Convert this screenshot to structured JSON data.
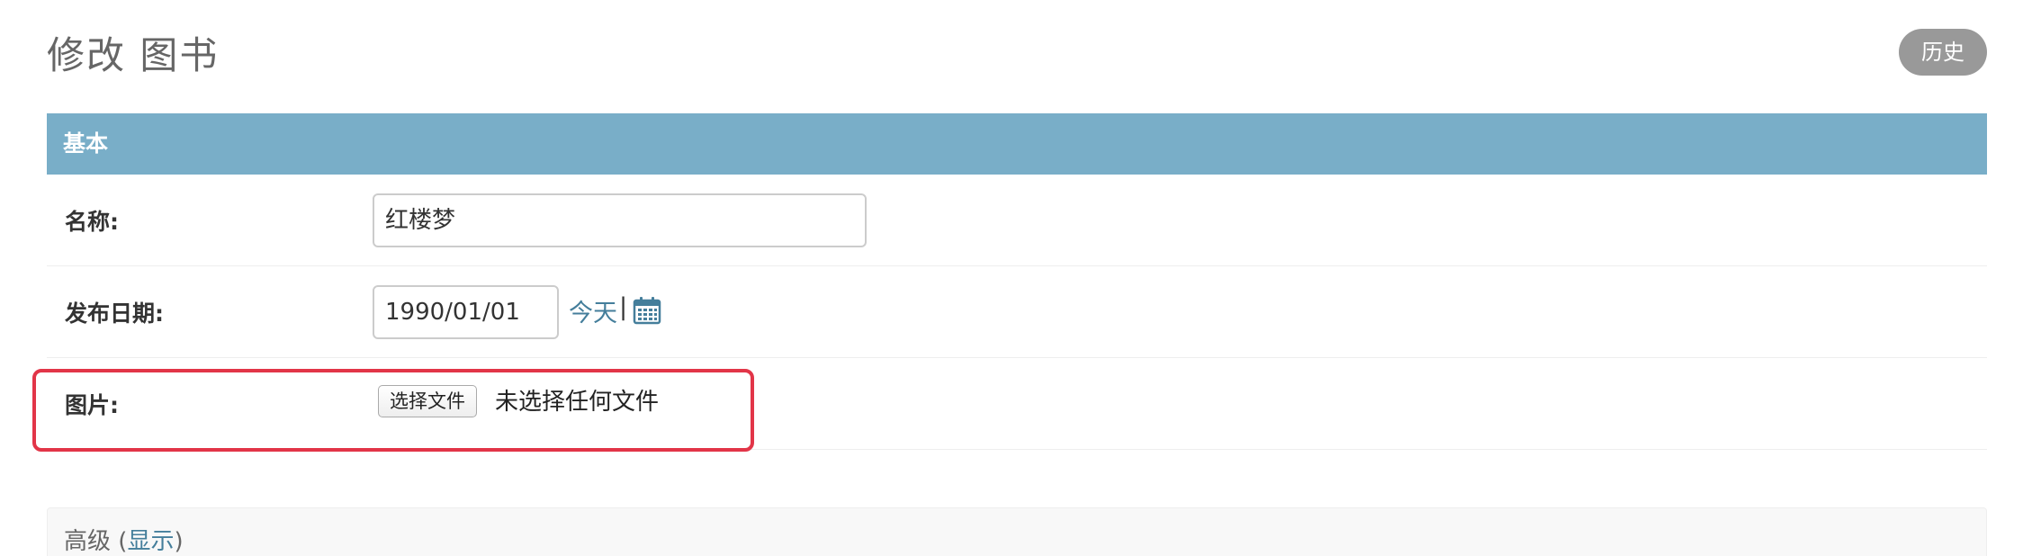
{
  "page": {
    "title": "修改 图书",
    "history_label": "历史"
  },
  "fieldset_basic": {
    "title": "基本",
    "fields": {
      "name": {
        "label": "名称:",
        "value": "红楼梦"
      },
      "publish_date": {
        "label": "发布日期:",
        "value": "1990/01/01",
        "today_link": "今天",
        "separator": "|",
        "icon": "calendar-icon"
      },
      "image": {
        "label": "图片:",
        "choose_button": "选择文件",
        "status": "未选择任何文件"
      }
    }
  },
  "fieldset_advanced": {
    "title": "高级",
    "open_paren": " (",
    "toggle_label": "显示",
    "close_paren": ")"
  },
  "colors": {
    "header_bg": "#79aec8",
    "link": "#447e9b",
    "history_button_bg": "#999999",
    "highlight": "#e23548"
  }
}
